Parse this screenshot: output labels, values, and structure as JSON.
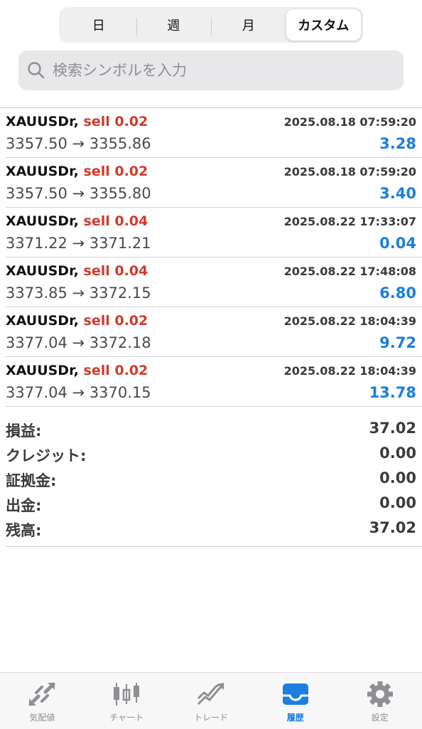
{
  "period_tabs": [
    "日",
    "週",
    "月",
    "カスタム"
  ],
  "active_period_tab": "カスタム",
  "search": {
    "placeholder": "検索シンボルを入力"
  },
  "trades": [
    {
      "symbol": "XAUUSDr,",
      "side": "sell 0.02",
      "time": "2025.08.18 07:59:20",
      "prices": "3357.50 → 3355.86",
      "profit": "3.28"
    },
    {
      "symbol": "XAUUSDr,",
      "side": "sell 0.02",
      "time": "2025.08.18 07:59:20",
      "prices": "3357.50 → 3355.80",
      "profit": "3.40"
    },
    {
      "symbol": "XAUUSDr,",
      "side": "sell 0.04",
      "time": "2025.08.22 17:33:07",
      "prices": "3371.22 → 3371.21",
      "profit": "0.04"
    },
    {
      "symbol": "XAUUSDr,",
      "side": "sell 0.04",
      "time": "2025.08.22 17:48:08",
      "prices": "3373.85 → 3372.15",
      "profit": "6.80"
    },
    {
      "symbol": "XAUUSDr,",
      "side": "sell 0.02",
      "time": "2025.08.22 18:04:39",
      "prices": "3377.04 → 3372.18",
      "profit": "9.72"
    },
    {
      "symbol": "XAUUSDr,",
      "side": "sell 0.02",
      "time": "2025.08.22 18:04:39",
      "prices": "3377.04 → 3370.15",
      "profit": "13.78"
    }
  ],
  "summary": [
    {
      "label": "損益:",
      "value": "37.02"
    },
    {
      "label": "クレジット:",
      "value": "0.00"
    },
    {
      "label": "証拠金:",
      "value": "0.00"
    },
    {
      "label": "出金:",
      "value": "0.00"
    },
    {
      "label": "残高:",
      "value": "37.02"
    }
  ],
  "tabbar": [
    {
      "label": "気配値",
      "icon": "quotes-icon"
    },
    {
      "label": "チャート",
      "icon": "candlestick-chart-icon"
    },
    {
      "label": "トレード",
      "icon": "trade-chart-icon"
    },
    {
      "label": "履歴",
      "icon": "history-inbox-icon"
    },
    {
      "label": "設定",
      "icon": "gear-icon"
    }
  ],
  "active_tab": "履歴",
  "colors": {
    "sell": "#d23a2a",
    "profit": "#1a7fe0",
    "active_tab": "#1a7fe0",
    "inactive_tab": "#8e8e93"
  }
}
